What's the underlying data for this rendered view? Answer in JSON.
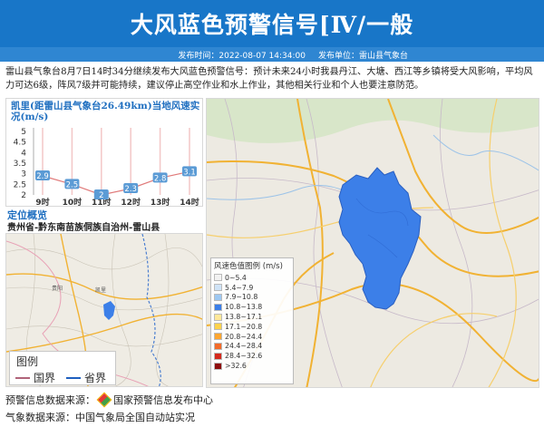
{
  "header": {
    "title": "大风蓝色预警信号[Ⅳ/一般",
    "publish_time_label": "发布时间：2022-08-07 14:34:00",
    "publish_unit_label": "发布单位：雷山县气象台"
  },
  "description": "雷山县气象台8月7日14时34分继续发布大风蓝色预警信号：预计未来24小时我县丹江、大塘、西江等乡镇将受大风影响，平均风力可达6级，阵风7级并可能持续，建议停止高空作业和水上作业，其他相关行业和个人也要注意防范。",
  "chart_data": {
    "type": "line",
    "title": "凯里(距雷山县气象台26.49km)当地风速实况(m/s)",
    "categories": [
      "9时",
      "10时",
      "11时",
      "12时",
      "13时",
      "14时"
    ],
    "values": [
      2.9,
      2.5,
      2.0,
      2.3,
      2.8,
      3.1
    ],
    "y_ticks": [
      "5",
      "4.5",
      "4",
      "3.5",
      "3",
      "2.5",
      "2"
    ],
    "ylim": [
      2,
      5
    ],
    "line_color": "#e07a7a",
    "label_bg": "#5b9bd5"
  },
  "location": {
    "title": "定位概览",
    "region": "贵州省-黔东南苗族侗族自治州-雷山县"
  },
  "map_legend": {
    "title": "图例",
    "items": [
      {
        "label": "国界",
        "color": "#b0637a"
      },
      {
        "label": "省界",
        "color": "#1f5fbf"
      }
    ]
  },
  "wind_legend": {
    "title": "风速色值图例 (m/s)",
    "items": [
      {
        "label": "0~5.4",
        "color": "#f2f2f2"
      },
      {
        "label": "5.4~7.9",
        "color": "#cfe3f7"
      },
      {
        "label": "7.9~10.8",
        "color": "#9ec8f2"
      },
      {
        "label": "10.8~13.8",
        "color": "#3c7fe8"
      },
      {
        "label": "13.8~17.1",
        "color": "#ffe89a"
      },
      {
        "label": "17.1~20.8",
        "color": "#ffd24d"
      },
      {
        "label": "20.8~24.4",
        "color": "#ffa631"
      },
      {
        "label": "24.4~28.4",
        "color": "#f26b2a"
      },
      {
        "label": "28.4~32.6",
        "color": "#d42b1f"
      },
      {
        "label": ">32.6",
        "color": "#8e0e0e"
      }
    ]
  },
  "footer": {
    "warning_source_label": "预警信息数据来源：",
    "warning_source_value": "国家预警信息发布中心",
    "weather_source_label": "气象数据来源：",
    "weather_source_value": "中国气象局全国自动站实况"
  },
  "colors": {
    "title_bg": "#1876c8",
    "meta_bg": "#2f86d2",
    "warning_area": "#3c7fe8",
    "accent_text": "#1f6fc0"
  }
}
